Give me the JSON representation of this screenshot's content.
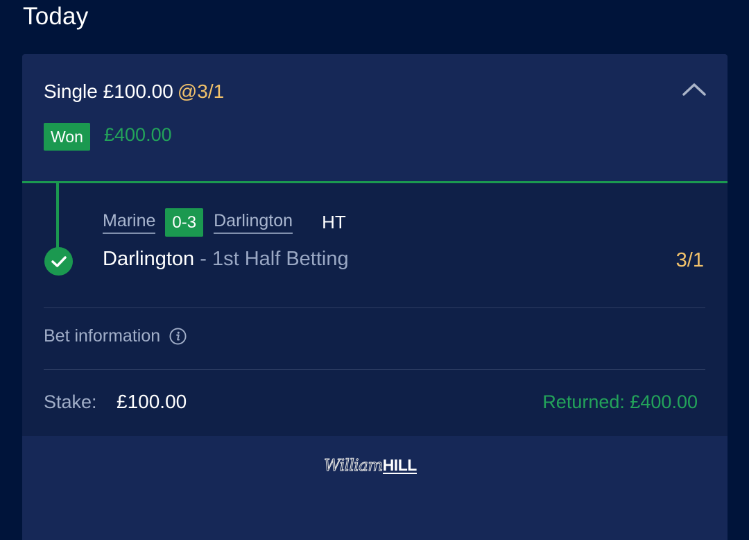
{
  "page": {
    "title": "Today"
  },
  "bet": {
    "type_stake": "Single £100.00",
    "odds": "@3/1",
    "status": "Won",
    "winnings": "£400.00",
    "match": {
      "home_team": "Marine",
      "score": "0-3",
      "away_team": "Darlington",
      "status": "HT"
    },
    "selection": {
      "name": "Darlington",
      "separator": " - ",
      "market": "1st Half Betting",
      "odds": "3/1"
    },
    "info_label": "Bet information",
    "stake_label": "Stake:",
    "stake_value": "£100.00",
    "returned": "Returned: £400.00"
  },
  "footer": {
    "logo_script": "William",
    "logo_bold": "HILL"
  },
  "colors": {
    "background": "#00143a",
    "card": "#0f2048",
    "card_header": "#162857",
    "accent_green": "#1b9950",
    "odds_gold": "#f2c26b"
  },
  "icons": [
    "chevron-up-icon",
    "check-icon",
    "info-icon"
  ]
}
